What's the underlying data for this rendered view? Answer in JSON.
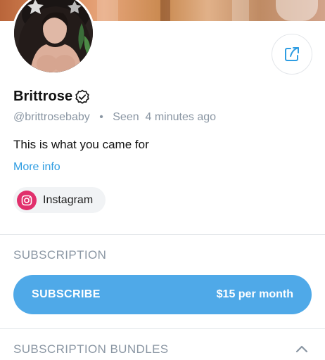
{
  "profile": {
    "name": "Brittrose",
    "username": "@brittrosebaby",
    "separator": "•",
    "seen": "Seen  4 minutes ago",
    "bio": "This is what you came for",
    "more_info": "More info"
  },
  "social": {
    "instagram_label": "Instagram",
    "instagram_icon": "instagram-icon",
    "instagram_color": "#e1306c"
  },
  "subscription": {
    "section_title": "SUBSCRIPTION",
    "button_label": "SUBSCRIBE",
    "price": "$15 per month",
    "button_color": "#4fa9e8"
  },
  "bundles": {
    "section_title": "SUBSCRIPTION BUNDLES",
    "toggle_icon": "chevron-up-icon"
  },
  "icons": {
    "share": "share-icon",
    "verified": "verified-badge-icon"
  },
  "colors": {
    "accent": "#2f9de2",
    "muted_text": "#8a96a3",
    "divider": "#e6e9ec"
  }
}
